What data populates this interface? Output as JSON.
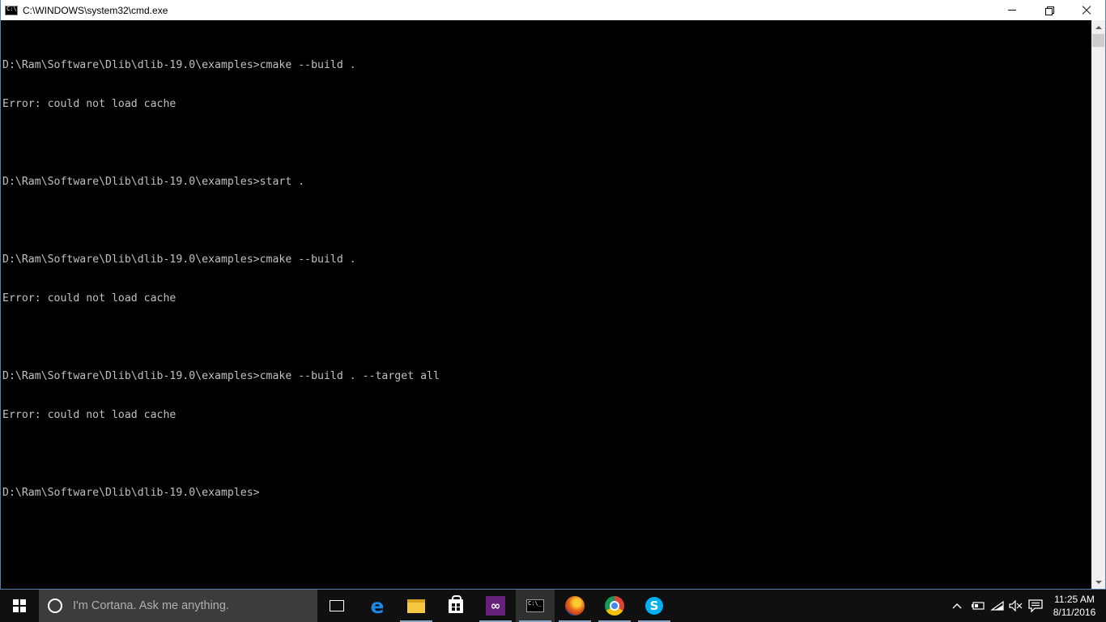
{
  "window": {
    "title": "C:\\WINDOWS\\system32\\cmd.exe"
  },
  "console": {
    "lines": [
      "D:\\Ram\\Software\\Dlib\\dlib-19.0\\examples>cmake --build .",
      "Error: could not load cache",
      "",
      "D:\\Ram\\Software\\Dlib\\dlib-19.0\\examples>start .",
      "",
      "D:\\Ram\\Software\\Dlib\\dlib-19.0\\examples>cmake --build .",
      "Error: could not load cache",
      "",
      "D:\\Ram\\Software\\Dlib\\dlib-19.0\\examples>cmake --build . --target all",
      "Error: could not load cache",
      "",
      "D:\\Ram\\Software\\Dlib\\dlib-19.0\\examples>"
    ],
    "text_color": "#c0c0c0",
    "background": "#000000"
  },
  "taskbar": {
    "search_placeholder": "I'm Cortana. Ask me anything.",
    "apps": [
      {
        "name": "task-view",
        "icon": "task-view-icon"
      },
      {
        "name": "edge",
        "icon": "edge-icon"
      },
      {
        "name": "file-explorer",
        "icon": "folder-icon"
      },
      {
        "name": "store",
        "icon": "store-icon"
      },
      {
        "name": "visual-studio",
        "icon": "vs-icon"
      },
      {
        "name": "command-prompt",
        "icon": "cmd-icon",
        "active": true
      },
      {
        "name": "firefox",
        "icon": "firefox-icon",
        "running": true
      },
      {
        "name": "chrome",
        "icon": "chrome-icon",
        "running": true
      },
      {
        "name": "skype",
        "icon": "skype-icon",
        "running": true
      }
    ],
    "clock": {
      "time": "11:25 AM",
      "date": "8/11/2016"
    }
  }
}
